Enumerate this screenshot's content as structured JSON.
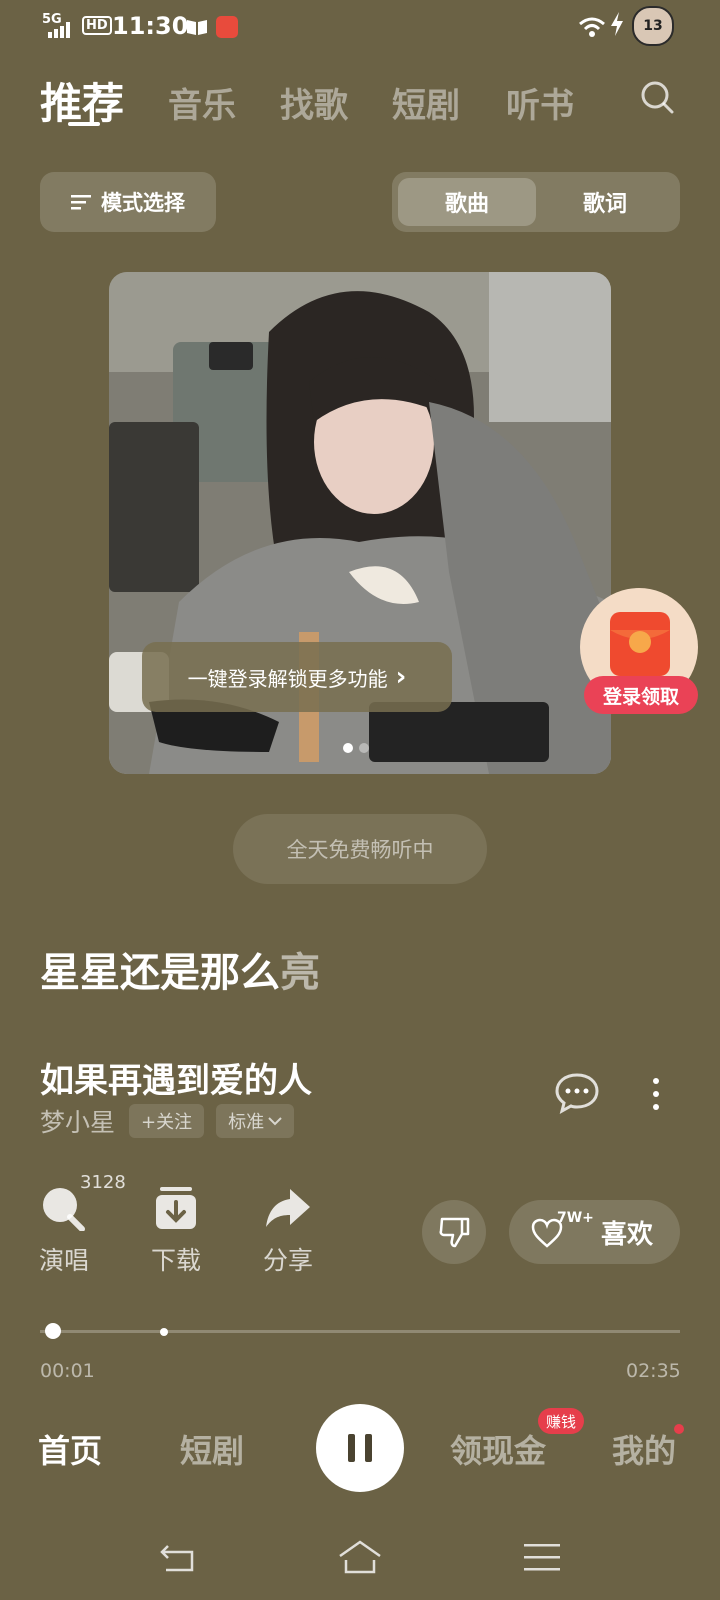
{
  "status_bar": {
    "network": "5G",
    "hd": "HD",
    "time": "11:30",
    "battery": "13"
  },
  "tabs": [
    "推荐",
    "音乐",
    "找歌",
    "短剧",
    "听书"
  ],
  "toolbar": {
    "mode_label": "模式选择",
    "segment": [
      "歌曲",
      "歌词"
    ]
  },
  "banner": {
    "login_text": "一键登录解锁更多功能",
    "login_chevron": "›",
    "redpacket_label": "登录领取"
  },
  "free_label": "全天免费畅听中",
  "lyric": {
    "bright": "星星还是那么",
    "fade": "亮"
  },
  "song": {
    "title": "如果再遇到爱的人",
    "artist": "梦小星",
    "follow": "+关注",
    "quality": "标准"
  },
  "actions": {
    "sing_count": "3128",
    "sing": "演唱",
    "download": "下载",
    "share": "分享",
    "like_count": "7W+",
    "like": "喜欢"
  },
  "progress": {
    "current": "00:01",
    "total": "02:35",
    "fraction": 0.006
  },
  "bottom_nav": {
    "home": "首页",
    "drama": "短剧",
    "cash": "领现金",
    "cash_badge": "赚钱",
    "mine": "我的"
  },
  "colors": {
    "background": "#6b6245",
    "badge": "#e63e4b"
  }
}
